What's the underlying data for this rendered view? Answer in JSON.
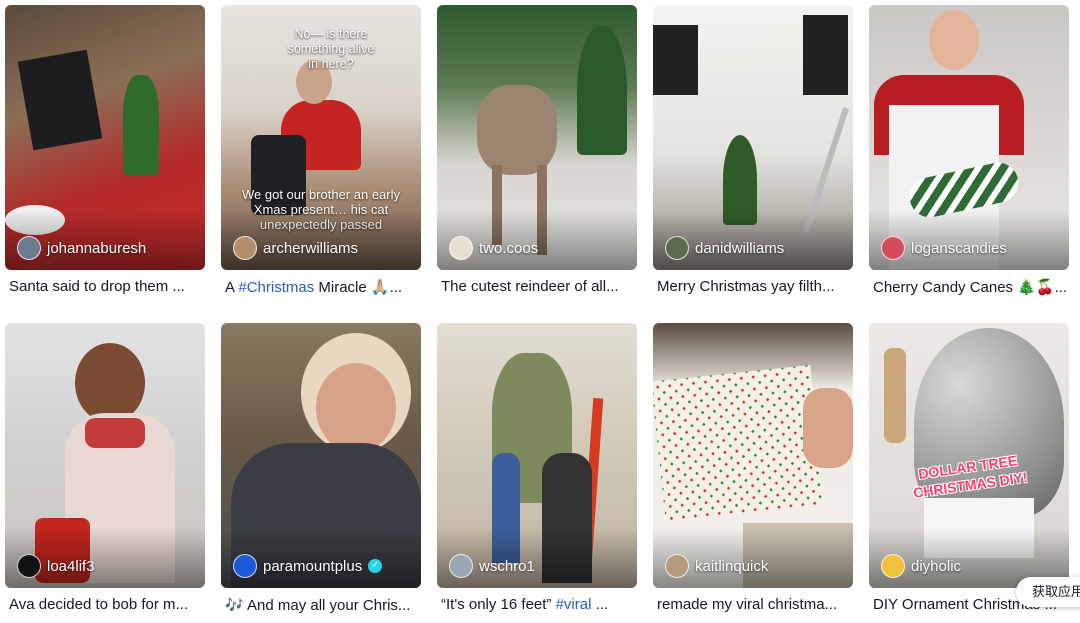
{
  "videos": [
    {
      "username": "johannaburesh",
      "caption": "Santa said to drop them ..."
    },
    {
      "username": "archerwilliams",
      "caption_prefix": "A ",
      "caption_hashtag": "#Christmas",
      "caption_suffix": " Miracle 🙏🏼...",
      "overlay_top": "No— is there something alive in here?",
      "overlay_mid": "We got our brother an early Xmas present… his cat unexpectedly passed"
    },
    {
      "username": "two.coos",
      "caption": "The cutest reindeer of all..."
    },
    {
      "username": "danidwilliams",
      "caption": "Merry Christmas yay filth..."
    },
    {
      "username": "loganscandies",
      "caption": "Cherry Candy Canes 🎄🍒..."
    },
    {
      "username": "loa4lif3",
      "caption": "Ava decided to bob for m..."
    },
    {
      "username": "paramountplus",
      "verified": true,
      "caption": "🎶 And may all your Chris..."
    },
    {
      "username": "wschro1",
      "caption_prefix": "“It's only 16 feet” ",
      "caption_hashtag": "#viral",
      "caption_suffix": " ..."
    },
    {
      "username": "kaitlinquick",
      "caption": "remade my viral christma..."
    },
    {
      "username": "diyholic",
      "caption": "DIY Ornament Christmas ...",
      "overlay_text": "DOLLAR TREE CHRISTMAS DIY!"
    }
  ],
  "get_app_label": "获取应用"
}
